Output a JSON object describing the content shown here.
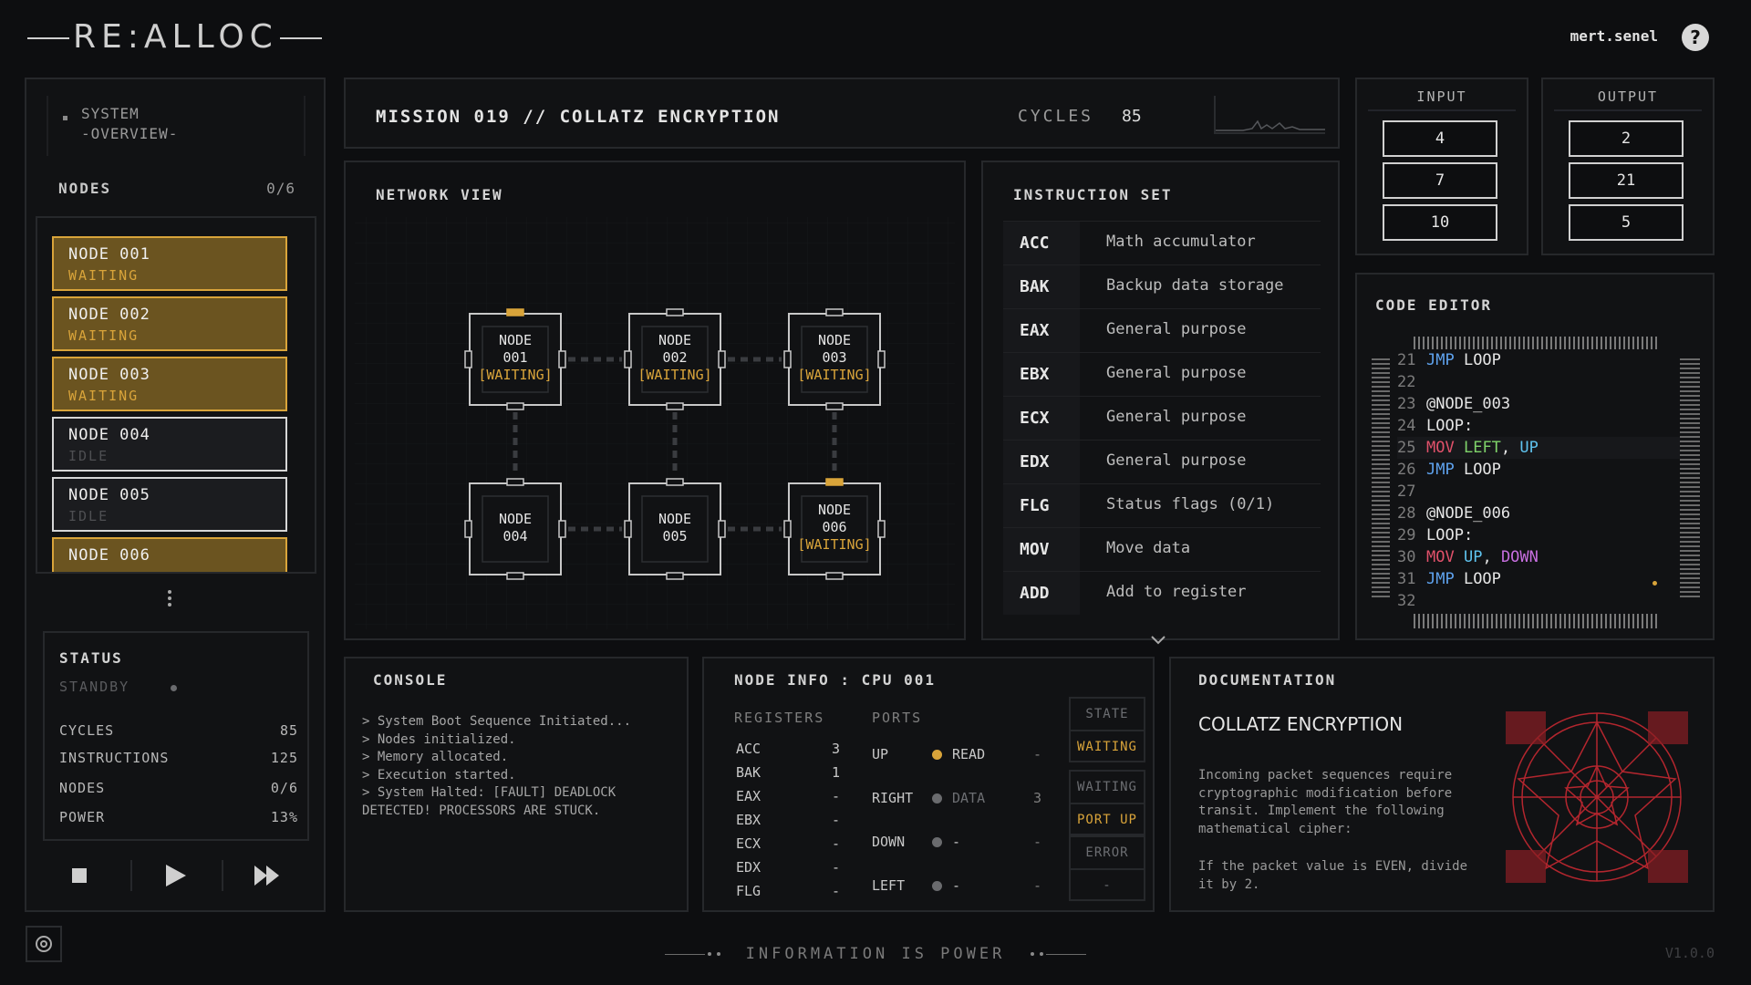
{
  "app": {
    "logo": "RE:ALLOC",
    "user": "mert.senel",
    "help": "?",
    "version": "V1.0.0",
    "motto": "INFORMATION IS POWER"
  },
  "colors": {
    "accent": "#d9a43a",
    "bg": "#0d0e10",
    "panel": "#111214",
    "border": "#26282b"
  },
  "sidebar": {
    "system_line1": "SYSTEM",
    "system_line2": "-OVERVIEW-",
    "nodes_label": "NODES",
    "nodes_count": "0/6",
    "nodes": [
      {
        "name": "NODE 001",
        "state": "WAITING"
      },
      {
        "name": "NODE 002",
        "state": "WAITING"
      },
      {
        "name": "NODE 003",
        "state": "WAITING"
      },
      {
        "name": "NODE 004",
        "state": "IDLE"
      },
      {
        "name": "NODE 005",
        "state": "IDLE"
      },
      {
        "name": "NODE 006",
        "state": ""
      }
    ],
    "status": {
      "title": "STATUS",
      "state": "STANDBY",
      "rows": [
        {
          "label": "CYCLES",
          "value": "85"
        },
        {
          "label": "INSTRUCTIONS",
          "value": "125"
        },
        {
          "label": "NODES",
          "value": "0/6"
        },
        {
          "label": "POWER",
          "value": "13%"
        }
      ]
    },
    "controls": [
      "stop-icon",
      "play-icon",
      "fast-forward-icon"
    ]
  },
  "mission": {
    "title": "MISSION 019 // COLLATZ ENCRYPTION",
    "cycles_label": "CYCLES",
    "cycles_value": "85"
  },
  "network": {
    "title": "NETWORK VIEW",
    "nodes": [
      {
        "l1": "NODE",
        "l2": "001",
        "l3": "[WAITING]"
      },
      {
        "l1": "NODE",
        "l2": "002",
        "l3": "[WAITING]"
      },
      {
        "l1": "NODE",
        "l2": "003",
        "l3": "[WAITING]"
      },
      {
        "l1": "NODE",
        "l2": "004",
        "l3": ""
      },
      {
        "l1": "NODE",
        "l2": "005",
        "l3": ""
      },
      {
        "l1": "NODE",
        "l2": "006",
        "l3": "[WAITING]"
      }
    ]
  },
  "instruction_set": {
    "title": "INSTRUCTION SET",
    "items": [
      {
        "op": "ACC",
        "desc": "Math accumulator"
      },
      {
        "op": "BAK",
        "desc": "Backup data storage"
      },
      {
        "op": "EAX",
        "desc": "General purpose"
      },
      {
        "op": "EBX",
        "desc": "General purpose"
      },
      {
        "op": "ECX",
        "desc": "General purpose"
      },
      {
        "op": "EDX",
        "desc": "General purpose"
      },
      {
        "op": "FLG",
        "desc": "Status flags (0/1)"
      },
      {
        "op": "MOV",
        "desc": "Move data"
      },
      {
        "op": "ADD",
        "desc": "Add to register"
      }
    ]
  },
  "input": {
    "title": "INPUT",
    "values": [
      "4",
      "7",
      "10"
    ]
  },
  "output": {
    "title": "OUTPUT",
    "values": [
      "2",
      "21",
      "5"
    ]
  },
  "code_editor": {
    "title": "CODE EDITOR",
    "lines": [
      {
        "n": "21",
        "tokens": [
          [
            "JMP",
            "jmp"
          ],
          [
            " LOOP",
            "txt"
          ]
        ]
      },
      {
        "n": "22",
        "tokens": []
      },
      {
        "n": "23",
        "tokens": [
          [
            "@NODE_003",
            "txt"
          ]
        ]
      },
      {
        "n": "24",
        "tokens": [
          [
            "LOOP:",
            "txt"
          ]
        ]
      },
      {
        "n": "25",
        "tokens": [
          [
            "MOV",
            "mov"
          ],
          [
            " ",
            "txt"
          ],
          [
            "LEFT",
            "left"
          ],
          [
            ", ",
            "txt"
          ],
          [
            "UP",
            "up"
          ]
        ],
        "active": true
      },
      {
        "n": "26",
        "tokens": [
          [
            "JMP",
            "jmp"
          ],
          [
            " LOOP",
            "txt"
          ]
        ]
      },
      {
        "n": "27",
        "tokens": []
      },
      {
        "n": "28",
        "tokens": [
          [
            "@NODE_006",
            "txt"
          ]
        ]
      },
      {
        "n": "29",
        "tokens": [
          [
            "LOOP:",
            "txt"
          ]
        ]
      },
      {
        "n": "30",
        "tokens": [
          [
            "MOV",
            "mov"
          ],
          [
            " ",
            "txt"
          ],
          [
            "UP",
            "up"
          ],
          [
            ", ",
            "txt"
          ],
          [
            "DOWN",
            "down"
          ]
        ]
      },
      {
        "n": "31",
        "tokens": [
          [
            "JMP",
            "jmp"
          ],
          [
            " LOOP",
            "txt"
          ]
        ]
      },
      {
        "n": "32",
        "tokens": []
      }
    ]
  },
  "console": {
    "title": "CONSOLE",
    "lines": [
      "> System Boot Sequence Initiated...",
      "> Nodes initialized.",
      "> Memory allocated.",
      "> Execution started.",
      "> System Halted: [FAULT] DEADLOCK",
      "DETECTED! PROCESSORS ARE STUCK."
    ]
  },
  "node_info": {
    "title": "NODE INFO : CPU 001",
    "registers_label": "REGISTERS",
    "ports_label": "PORTS",
    "registers": [
      {
        "name": "ACC",
        "value": "3"
      },
      {
        "name": "BAK",
        "value": "1"
      },
      {
        "name": "EAX",
        "value": "-"
      },
      {
        "name": "EBX",
        "value": "-"
      },
      {
        "name": "ECX",
        "value": "-"
      },
      {
        "name": "EDX",
        "value": "-"
      },
      {
        "name": "FLG",
        "value": "-"
      }
    ],
    "ports": [
      {
        "name": "UP",
        "mode": "READ",
        "value": "-",
        "active": true
      },
      {
        "name": "RIGHT",
        "mode": "DATA",
        "value": "3",
        "active": false
      },
      {
        "name": "DOWN",
        "mode": "-",
        "value": "-",
        "active": false
      },
      {
        "name": "LEFT",
        "mode": "-",
        "value": "-",
        "active": false
      }
    ],
    "state_label": "STATE",
    "state_value": "WAITING",
    "waiting_label": "WAITING",
    "waiting_value": "PORT UP",
    "error_label": "ERROR",
    "error_value": "-"
  },
  "documentation": {
    "title": "DOCUMENTATION",
    "heading": "COLLATZ ENCRYPTION",
    "para1": "Incoming packet sequences require cryptographic modification before transit. Implement the following mathematical cipher:",
    "para2": "If the packet value is EVEN, divide it by 2."
  }
}
